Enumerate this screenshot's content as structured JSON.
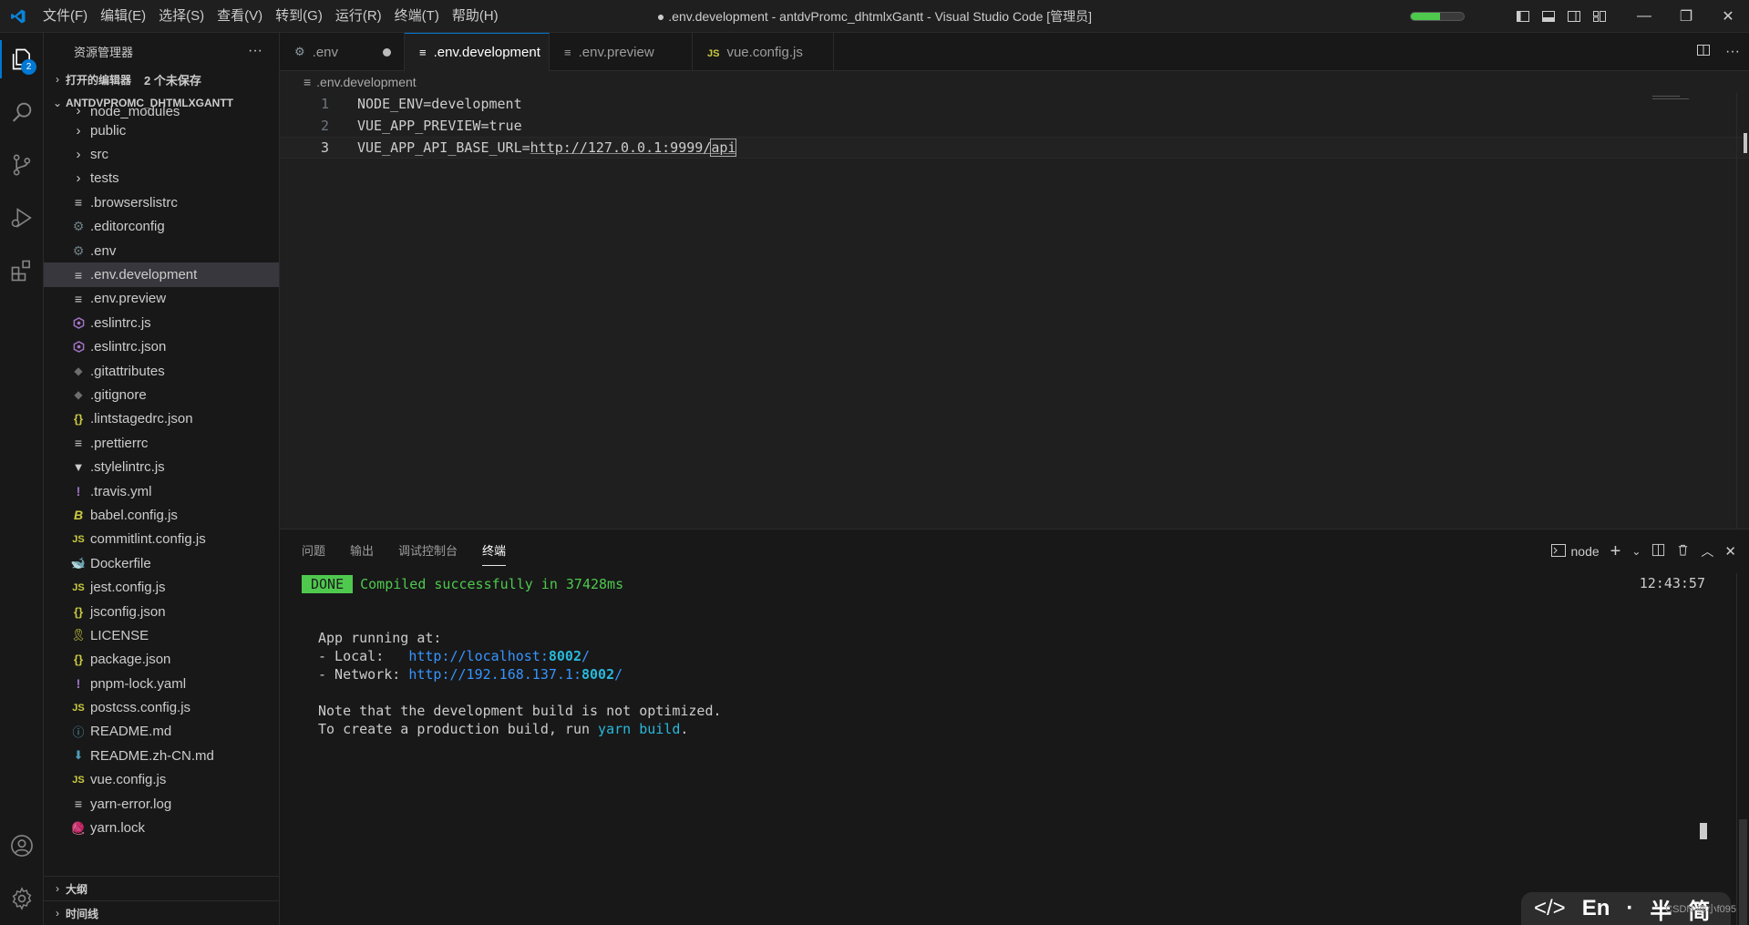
{
  "titlebar": {
    "menu": [
      "文件(F)",
      "编辑(E)",
      "选择(S)",
      "查看(V)",
      "转到(G)",
      "运行(R)",
      "终端(T)",
      "帮助(H)"
    ],
    "window_title": "● .env.development - antdvPromc_dhtmlxGantt - Visual Studio Code [管理员]",
    "progress": 0.55,
    "window_buttons": [
      "—",
      "❐",
      "✕"
    ]
  },
  "activitybar": {
    "explorer_badge": "2"
  },
  "sidebar": {
    "title": "资源管理器",
    "more": "···",
    "open_editors": "打开的编辑器",
    "unsaved": "2 个未保存",
    "project": "ANTDVPROMC_DHTMLXGANTT",
    "items": [
      {
        "label": "node_modules",
        "type": "folder",
        "icon": "chevron-right"
      },
      {
        "label": "public",
        "type": "folder",
        "icon": "chevron-right"
      },
      {
        "label": "src",
        "type": "folder",
        "icon": "chevron-right"
      },
      {
        "label": "tests",
        "type": "folder",
        "icon": "chevron-right"
      },
      {
        "label": ".browserslistrc",
        "type": "file",
        "icon": "lines",
        "color": "#cccccc"
      },
      {
        "label": ".editorconfig",
        "type": "file",
        "icon": "gear",
        "color": "#6d8086"
      },
      {
        "label": ".env",
        "type": "file",
        "icon": "gear",
        "color": "#6d8086"
      },
      {
        "label": ".env.development",
        "type": "file",
        "icon": "lines",
        "color": "#cccccc",
        "selected": true
      },
      {
        "label": ".env.preview",
        "type": "file",
        "icon": "lines",
        "color": "#cccccc"
      },
      {
        "label": ".eslintrc.js",
        "type": "file",
        "icon": "eslint",
        "color": "#a074c4"
      },
      {
        "label": ".eslintrc.json",
        "type": "file",
        "icon": "eslint",
        "color": "#a074c4"
      },
      {
        "label": ".gitattributes",
        "type": "file",
        "icon": "git",
        "color": "#41535b"
      },
      {
        "label": ".gitignore",
        "type": "file",
        "icon": "git",
        "color": "#41535b"
      },
      {
        "label": ".lintstagedrc.json",
        "type": "file",
        "icon": "braces",
        "color": "#cbcb41"
      },
      {
        "label": ".prettierrc",
        "type": "file",
        "icon": "lines",
        "color": "#cccccc"
      },
      {
        "label": ".stylelintrc.js",
        "type": "file",
        "icon": "stylelint",
        "color": "#cccccc"
      },
      {
        "label": ".travis.yml",
        "type": "file",
        "icon": "exclaim",
        "color": "#a074c4"
      },
      {
        "label": "babel.config.js",
        "type": "file",
        "icon": "babel",
        "color": "#cbcb41"
      },
      {
        "label": "commitlint.config.js",
        "type": "file",
        "icon": "js",
        "color": "#cbcb41"
      },
      {
        "label": "Dockerfile",
        "type": "file",
        "icon": "docker",
        "color": "#519aba"
      },
      {
        "label": "jest.config.js",
        "type": "file",
        "icon": "js",
        "color": "#cbcb41"
      },
      {
        "label": "jsconfig.json",
        "type": "file",
        "icon": "braces",
        "color": "#cbcb41"
      },
      {
        "label": "LICENSE",
        "type": "file",
        "icon": "license",
        "color": "#cbcb41"
      },
      {
        "label": "package.json",
        "type": "file",
        "icon": "braces",
        "color": "#cbcb41"
      },
      {
        "label": "pnpm-lock.yaml",
        "type": "file",
        "icon": "exclaim",
        "color": "#a074c4"
      },
      {
        "label": "postcss.config.js",
        "type": "file",
        "icon": "js",
        "color": "#cbcb41"
      },
      {
        "label": "README.md",
        "type": "file",
        "icon": "info",
        "color": "#519aba"
      },
      {
        "label": "README.zh-CN.md",
        "type": "file",
        "icon": "download",
        "color": "#519aba"
      },
      {
        "label": "vue.config.js",
        "type": "file",
        "icon": "js",
        "color": "#cbcb41"
      },
      {
        "label": "yarn-error.log",
        "type": "file",
        "icon": "lines",
        "color": "#cccccc"
      },
      {
        "label": "yarn.lock",
        "type": "file",
        "icon": "yarn",
        "color": "#519aba"
      }
    ],
    "outline": "大纲",
    "timeline": "时间线"
  },
  "tabs": [
    {
      "label": ".env",
      "icon": "gear",
      "dirty": true,
      "active": false
    },
    {
      "label": ".env.development",
      "icon": "lines",
      "dirty": true,
      "active": true
    },
    {
      "label": ".env.preview",
      "icon": "lines",
      "dirty": false,
      "active": false
    },
    {
      "label": "vue.config.js",
      "icon": "JS",
      "dirty": false,
      "active": false
    }
  ],
  "breadcrumb": ".env.development",
  "editor": {
    "lines": [
      {
        "num": "1",
        "text": "NODE_ENV=development"
      },
      {
        "num": "2",
        "text": "VUE_APP_PREVIEW=true"
      },
      {
        "num": "3",
        "prefix": "VUE_APP_API_BASE_URL=",
        "url": "http://127.0.0.1:9999/",
        "sel": "api"
      }
    ]
  },
  "panel": {
    "tabs": [
      "问题",
      "输出",
      "调试控制台",
      "终端"
    ],
    "active_tab": "终端",
    "terminal_name": "node",
    "terminal": {
      "done": "DONE",
      "compiled": "Compiled successfully in 37428ms",
      "time": "12:43:57",
      "running": "App running at:",
      "local_label": "- Local:   ",
      "local_url_prefix": "http://localhost:",
      "local_port": "8002",
      "local_url_suffix": "/",
      "network_label": "- Network: ",
      "network_url_prefix": "http://192.168.137.1:",
      "network_port": "8002",
      "network_url_suffix": "/",
      "note": "Note that the development build is not optimized.",
      "build_prefix": "To create a production build, run ",
      "build_cmd": "yarn build",
      "build_suffix": "."
    }
  },
  "ime": {
    "code": "</>",
    "lang": "En",
    "punct": "·",
    "width": "半",
    "extra": "简"
  },
  "watermark": "CSDN @小f095"
}
